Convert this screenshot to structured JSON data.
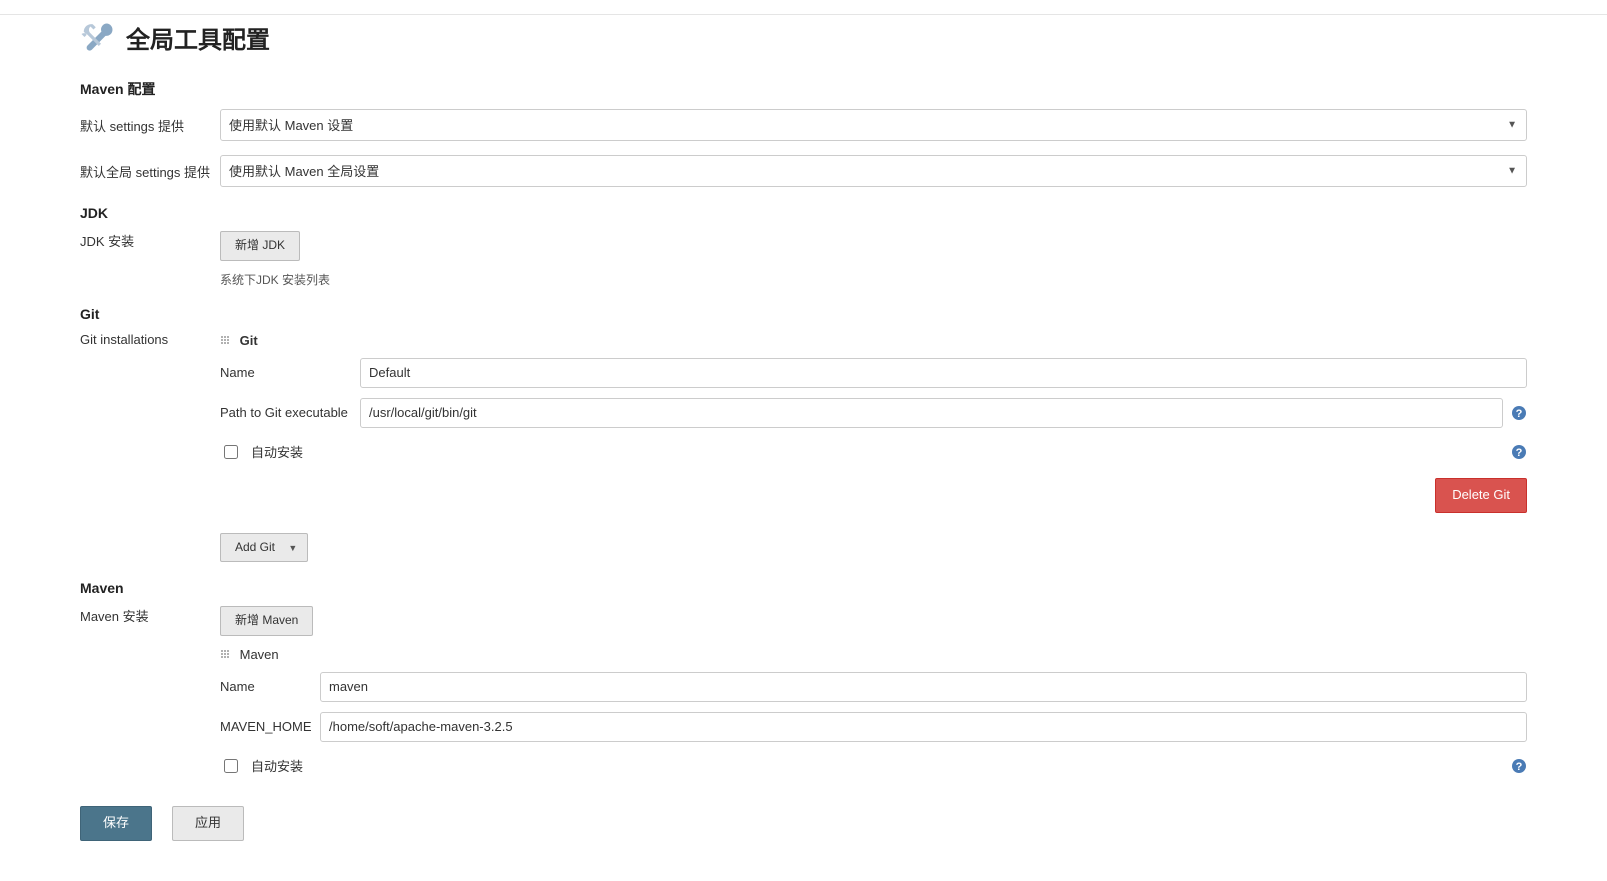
{
  "page": {
    "title": "全局工具配置"
  },
  "maven_config": {
    "heading": "Maven 配置",
    "default_settings_label": "默认 settings 提供",
    "default_settings_value": "使用默认 Maven 设置",
    "default_global_settings_label": "默认全局 settings 提供",
    "default_global_settings_value": "使用默认 Maven 全局设置"
  },
  "jdk": {
    "heading": "JDK",
    "install_label": "JDK 安装",
    "add_button": "新增 JDK",
    "list_text": "系统下JDK 安装列表"
  },
  "git": {
    "heading": "Git",
    "installations_label": "Git installations",
    "tool_title": "Git",
    "name_label": "Name",
    "name_value": "Default",
    "path_label": "Path to Git executable",
    "path_value": "/usr/local/git/bin/git",
    "auto_install_label": "自动安装",
    "delete_button": "Delete Git",
    "add_button": "Add Git"
  },
  "maven": {
    "heading": "Maven",
    "install_label": "Maven 安装",
    "add_button": "新增 Maven",
    "tool_title": "Maven",
    "name_label": "Name",
    "name_value": "maven",
    "home_label": "MAVEN_HOME",
    "home_value": "/home/soft/apache-maven-3.2.5",
    "auto_install_label": "自动安装"
  },
  "actions": {
    "save": "保存",
    "apply": "应用"
  }
}
